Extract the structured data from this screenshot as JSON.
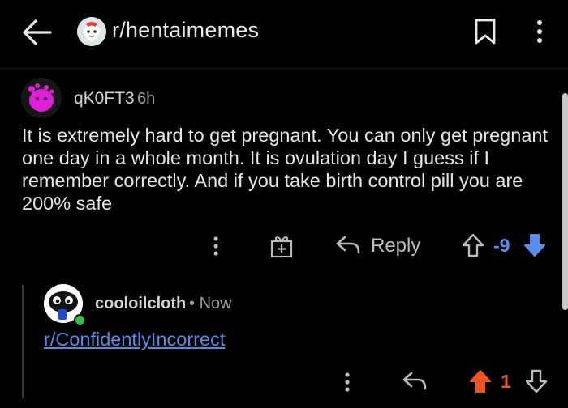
{
  "header": {
    "subreddit": "r/hentaimemes"
  },
  "comment": {
    "author": "qK0FT3",
    "time": "6h",
    "body": "It is extremely hard to get pregnant. You can only get pregnant one day in a whole month. It is ovulation day I guess if I remember correctly. And if you take birth control pill you are 200% safe",
    "reply_label": "Reply",
    "score": "-9",
    "vote_state": "downvoted",
    "score_color": "#5b8cf0"
  },
  "reply": {
    "author": "cooloilcloth",
    "separator": "•",
    "time": "Now",
    "link_text": "r/ConfidentlyIncorrect",
    "score": "1",
    "vote_state": "upvoted",
    "score_color": "#f0551f",
    "online": true
  },
  "icons": [
    "back-arrow-icon",
    "subreddit-avatar-icon",
    "bookmark-icon",
    "more-vertical-icon",
    "award-icon",
    "reply-icon",
    "upvote-icon",
    "downvote-icon"
  ]
}
